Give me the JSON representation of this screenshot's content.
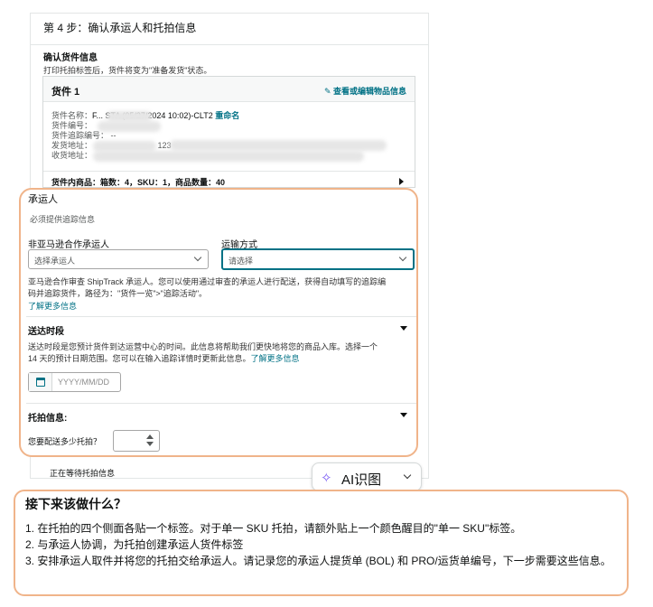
{
  "step": {
    "title": "第 4 步：确认承运人和托拍信息",
    "confirm_title": "确认货件信息",
    "confirm_sub": "打印托拍标签后，货件将变为\"准备发货\"状态。"
  },
  "shipment": {
    "title": "货件 1",
    "edit_link": "查看或编辑物品信息",
    "name_label": "货件名称：",
    "name_value": "F... STA (05/27/2024 10:02)-CLT2",
    "rename_link": "重命名",
    "id_label": "货件编号：",
    "tracking_label": "货件追踪编号：",
    "tracking_value": "--",
    "from_label": "发货地址：",
    "from_value": "123",
    "to_label": "收货地址：",
    "contents": "货件内商品：箱数：4，SKU：1，商品数量：40"
  },
  "carrier": {
    "title": "承运人",
    "required": "必须提供追踪信息",
    "noncarrier_label": "非亚马逊合作承运人",
    "noncarrier_placeholder": "选择承运人",
    "mode_label": "运输方式",
    "mode_placeholder": "请选择",
    "desc_line1": "亚马逊合作审查 ShipTrack 承运人。您可以使用通过审查的承运人进行配送，获得自动填写的追踪编",
    "desc_line2": "码并追踪货件，路径为：\"货件一览\">\"追踪活动\"。",
    "more_link": "了解更多信息"
  },
  "delivery": {
    "title": "送达时段",
    "desc_line1": "送达时段是您预计货件到达运营中心的时间。此信息将帮助我们更快地将您的商品入库。选择一个",
    "desc_line2": "14 天的预计日期范围。您可以在输入追踪详情时更新此信息。",
    "more_link": "了解更多信息",
    "date_placeholder": "YYYY/MM/DD"
  },
  "pallet": {
    "title": "托拍信息:",
    "question": "您要配送多少托拍？"
  },
  "waiting": "正在等待托拍信息",
  "ai_button": {
    "icon": "✧",
    "label": "AI识图"
  },
  "next_steps": {
    "title": "接下来该做什么？",
    "items": [
      "1. 在托拍的四个侧面各贴一个标签。对于单一 SKU 托拍，请额外贴上一个颜色醒目的\"单一 SKU\"标签。",
      "2. 与承运人协调，为托拍创建承运人货件标签",
      "3. 安排承运人取件并将您的托拍交给承运人。请记录您的承运人提货单 (BOL) 和 PRO/运货单编号，下一步需要这些信息。"
    ]
  },
  "colors": {
    "accent": "#007185",
    "highlight_border": "#f0b48a",
    "ai_icon": "#7b5cf5"
  }
}
